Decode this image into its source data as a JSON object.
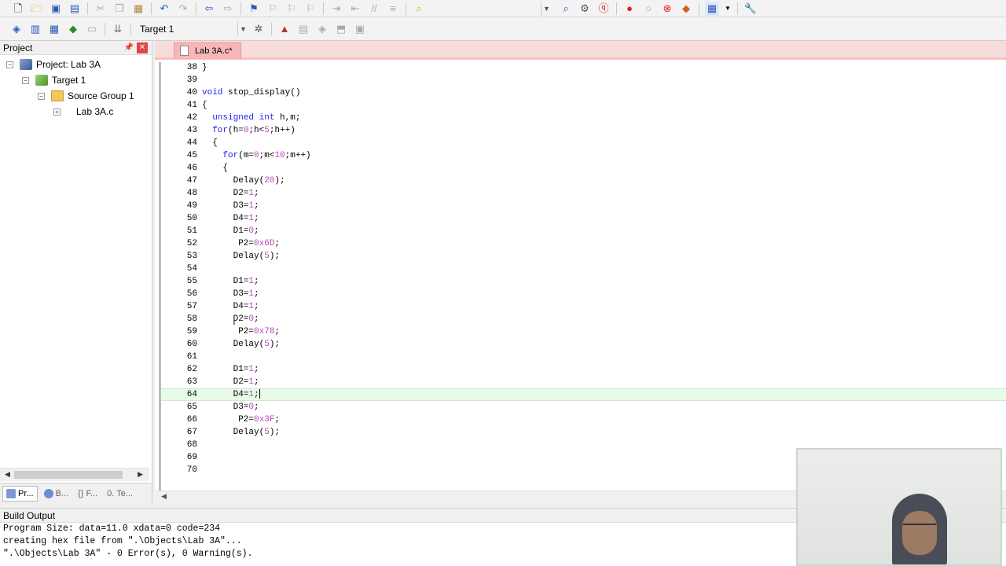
{
  "toolbar1": {
    "icons": [
      "new-file",
      "open-file",
      "save",
      "save-all",
      "cut",
      "copy",
      "paste",
      "undo",
      "redo",
      "nav-back",
      "nav-forward",
      "bookmark",
      "bookmark-prev",
      "bookmark-next",
      "bookmark-clear",
      "indent",
      "unindent",
      "comment",
      "uncomment",
      "find-in-files",
      "dropdown",
      "find",
      "debug-settings",
      "start-debug",
      "breakpoint",
      "breakpoint-disable",
      "breakpoint-kill",
      "breakpoint-all",
      "window-layout",
      "configure"
    ]
  },
  "toolbar2": {
    "target_label": "Target 1",
    "icons": [
      "translate",
      "build",
      "rebuild",
      "batch-build",
      "stop-build",
      "download",
      "target-options",
      "manage-components",
      "manage-rte",
      "select-packs",
      "run-env"
    ]
  },
  "project_panel": {
    "title": "Project",
    "tree": [
      {
        "label": "Project: Lab 3A",
        "icon": "project-icon"
      },
      {
        "label": "Target 1",
        "icon": "target-icon"
      },
      {
        "label": "Source Group 1",
        "icon": "folder-icon"
      },
      {
        "label": "Lab 3A.c",
        "icon": "file-icon"
      }
    ],
    "tabs": [
      {
        "label": "Pr...",
        "active": true
      },
      {
        "label": "B...",
        "active": false
      },
      {
        "label": "{} F...",
        "active": false
      },
      {
        "label": "0. Te...",
        "active": false
      }
    ]
  },
  "editor": {
    "tab_label": "Lab 3A.c*",
    "current_line": 64,
    "lines": [
      {
        "n": "38",
        "t": "}"
      },
      {
        "n": "39",
        "t": ""
      },
      {
        "n": "40",
        "t": "void stop_display()"
      },
      {
        "n": "41",
        "t": "{"
      },
      {
        "n": "42",
        "t": "  unsigned int h,m;"
      },
      {
        "n": "43",
        "t": "  for(h=0;h<5;h++)"
      },
      {
        "n": "44",
        "t": "  {"
      },
      {
        "n": "45",
        "t": "    for(m=0;m<10;m++)"
      },
      {
        "n": "46",
        "t": "    {"
      },
      {
        "n": "47",
        "t": "      Delay(20);"
      },
      {
        "n": "48",
        "t": "      D2=1;"
      },
      {
        "n": "49",
        "t": "      D3=1;"
      },
      {
        "n": "50",
        "t": "      D4=1;"
      },
      {
        "n": "51",
        "t": "      D1=0;"
      },
      {
        "n": "52",
        "t": "       P2=0x6D;"
      },
      {
        "n": "53",
        "t": "      Delay(5);"
      },
      {
        "n": "54",
        "t": ""
      },
      {
        "n": "55",
        "t": "      D1=1;"
      },
      {
        "n": "56",
        "t": "      D3=1;"
      },
      {
        "n": "57",
        "t": "      D4=1;"
      },
      {
        "n": "58",
        "t": "      D2=0;"
      },
      {
        "n": "59",
        "t": "       P2=0x78;"
      },
      {
        "n": "60",
        "t": "      Delay(5);"
      },
      {
        "n": "61",
        "t": ""
      },
      {
        "n": "62",
        "t": "      D1=1;"
      },
      {
        "n": "63",
        "t": "      D2=1;"
      },
      {
        "n": "64",
        "t": "      D4=1;"
      },
      {
        "n": "65",
        "t": "      D3=0;"
      },
      {
        "n": "66",
        "t": "       P2=0x3F;"
      },
      {
        "n": "67",
        "t": "      Delay(5);"
      },
      {
        "n": "68",
        "t": ""
      },
      {
        "n": "69",
        "t": ""
      },
      {
        "n": "70",
        "t": ""
      }
    ]
  },
  "build_output": {
    "title": "Build Output",
    "lines": [
      "Program Size: data=11.0 xdata=0 code=234",
      "creating hex file from \".\\Objects\\Lab 3A\"...",
      "\".\\Objects\\Lab 3A\" - 0 Error(s), 0 Warning(s)."
    ]
  },
  "colors": {
    "keyword": "#1f1fff",
    "number": "#c044c0",
    "tab_active": "#f7b7b7",
    "current_line": "#e8fbe8"
  }
}
